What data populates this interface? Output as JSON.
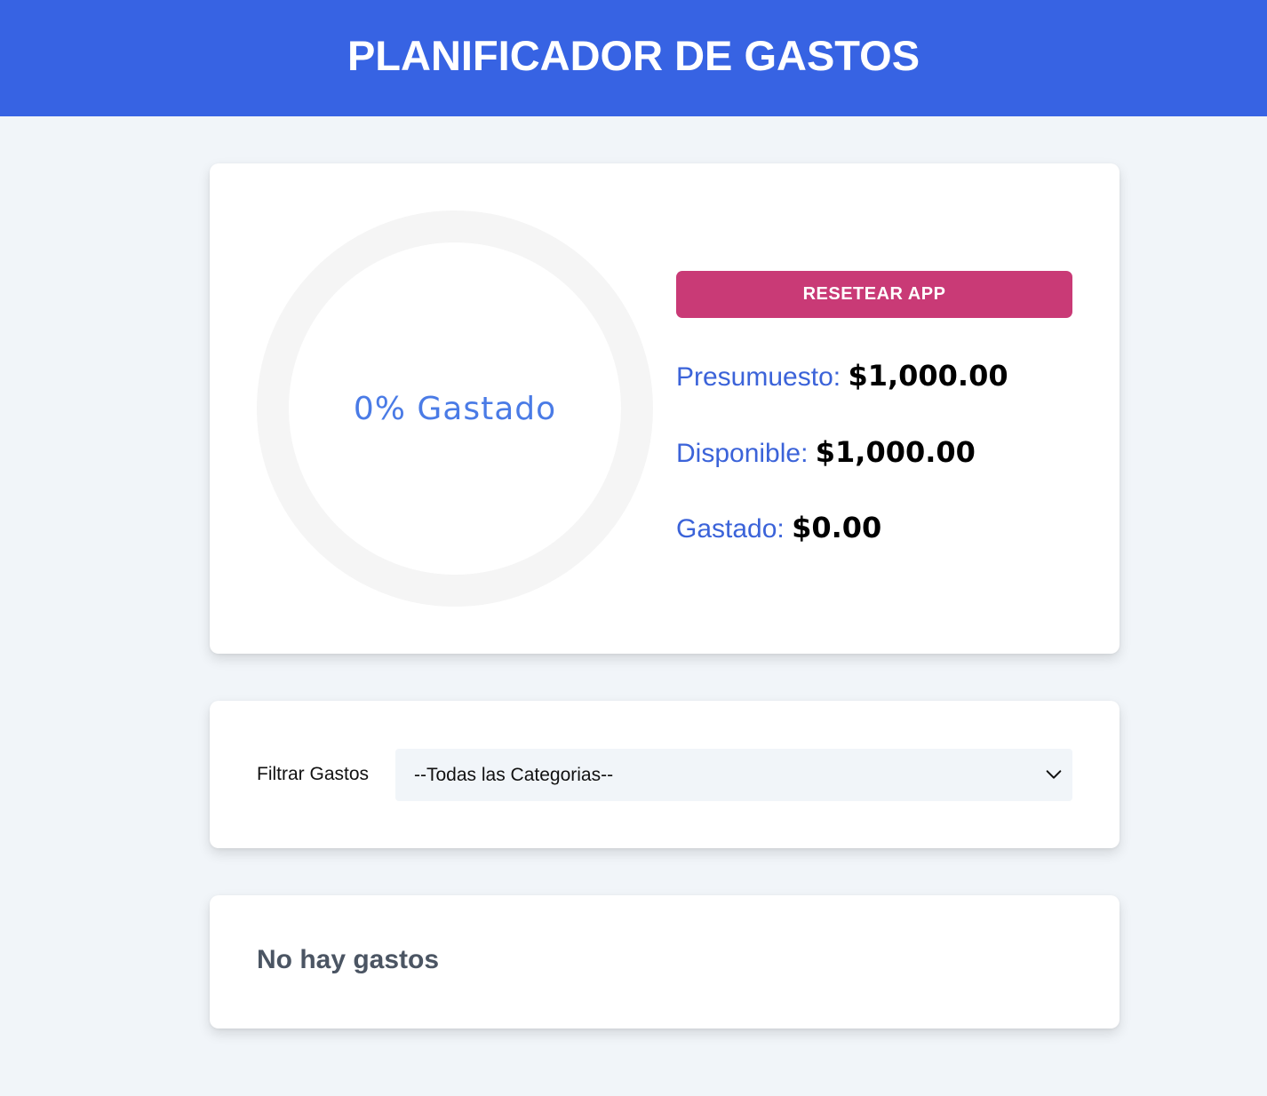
{
  "header": {
    "title": "PLANIFICADOR DE GASTOS"
  },
  "budget": {
    "progress_percent": 0,
    "progress_label": "0% Gastado",
    "reset_label": "RESETEAR APP",
    "budget_label": "Presumuesto:",
    "budget_value": "$1,000.00",
    "available_label": "Disponible:",
    "available_value": "$1,000.00",
    "spent_label": "Gastado:",
    "spent_value": "$0.00"
  },
  "filter": {
    "label": "Filtrar Gastos",
    "selected": "--Todas las Categorias--"
  },
  "expenses": {
    "empty_message": "No hay gastos"
  },
  "colors": {
    "header_bg": "#3763e3",
    "reset_button": "#c93a76",
    "accent_text": "#3b63d9",
    "ring_track": "#f5f5f5",
    "ring_progress": "#3b82f6"
  }
}
